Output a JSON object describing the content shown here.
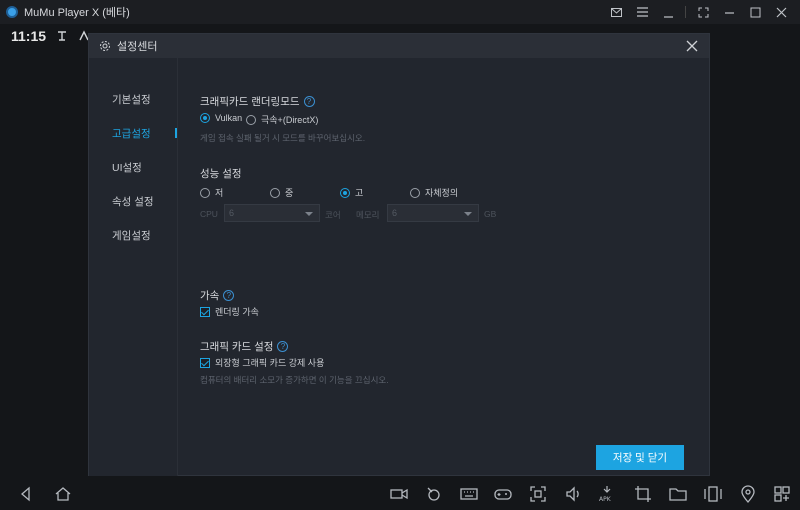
{
  "window": {
    "title": "MuMu Player X (베타)"
  },
  "status": {
    "time": "11:15"
  },
  "dialog": {
    "title": "설정센터",
    "save_label": "저장 및 닫기"
  },
  "sidebar": {
    "items": [
      {
        "label": "기본설정",
        "active": false
      },
      {
        "label": "고급설정",
        "active": true
      },
      {
        "label": "UI설정",
        "active": false
      },
      {
        "label": "속성 설정",
        "active": false
      },
      {
        "label": "게임설정",
        "active": false
      }
    ]
  },
  "render": {
    "title": "크래픽카드 랜더링모드",
    "options": [
      {
        "label": "Vulkan",
        "selected": true
      },
      {
        "label": "극속+(DirectX)",
        "selected": false
      }
    ],
    "hint": "게임 접속 실패 될거 시 모드를 바꾸어보십시오."
  },
  "performance": {
    "title": "성능 설정",
    "options": [
      {
        "label": "저",
        "selected": false
      },
      {
        "label": "중",
        "selected": false
      },
      {
        "label": "고",
        "selected": true
      },
      {
        "label": "자체정의",
        "selected": false
      }
    ],
    "cpu_label": "CPU",
    "cpu_value": "6",
    "cpu_unit": "코어",
    "mem_label": "메모리",
    "mem_value": "6",
    "mem_unit": "GB"
  },
  "accel": {
    "title": "가속",
    "checkbox_label": "렌더링 가속",
    "checked": true
  },
  "graphics": {
    "title": "그래픽 카드 설정",
    "checkbox_label": "외장형 그래픽 카드 강제 사용",
    "checked": true,
    "hint": "컴퓨터의 배터리 소모가 증가하면 이 기능을 끄십시오."
  },
  "colors": {
    "accent": "#1da4e1",
    "dialog_bg": "#22262e",
    "page_bg": "#141619"
  },
  "icons": {
    "titlebar": [
      "mail-icon",
      "settings-icon",
      "minimize-icon",
      "expand-icon",
      "minimize-window-icon",
      "maximize-icon",
      "close-icon"
    ],
    "bottombar": [
      "back-icon",
      "home-icon",
      "record-icon",
      "controller-icon",
      "keyboard-icon",
      "gamepad-icon",
      "screenshot-icon",
      "volume-icon",
      "apk-icon",
      "crop-icon",
      "folder-icon",
      "multi-instance-icon",
      "location-icon",
      "more-icon"
    ]
  }
}
